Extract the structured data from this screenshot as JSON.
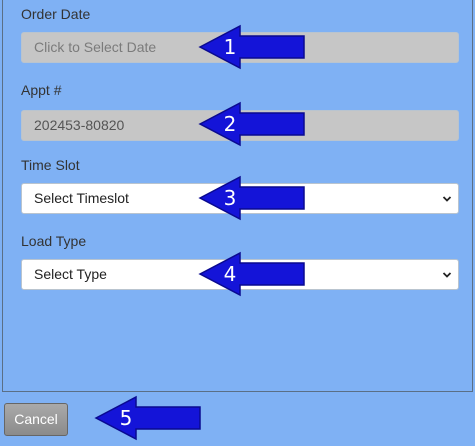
{
  "form": {
    "order_date": {
      "label": "Order Date",
      "placeholder": "Click to Select Date"
    },
    "appt": {
      "label": "Appt #",
      "value": "202453-80820"
    },
    "time_slot": {
      "label": "Time Slot",
      "selected": "Select Timeslot"
    },
    "load_type": {
      "label": "Load Type",
      "selected": "Select Type"
    }
  },
  "footer": {
    "cancel_label": "Cancel"
  },
  "annotations": [
    "1",
    "2",
    "3",
    "4",
    "5"
  ],
  "colors": {
    "background": "#7fb1f4",
    "arrow": "#1414d8",
    "readonly_field": "#c6c6c6",
    "cancel_button": "#9a9a9a"
  }
}
